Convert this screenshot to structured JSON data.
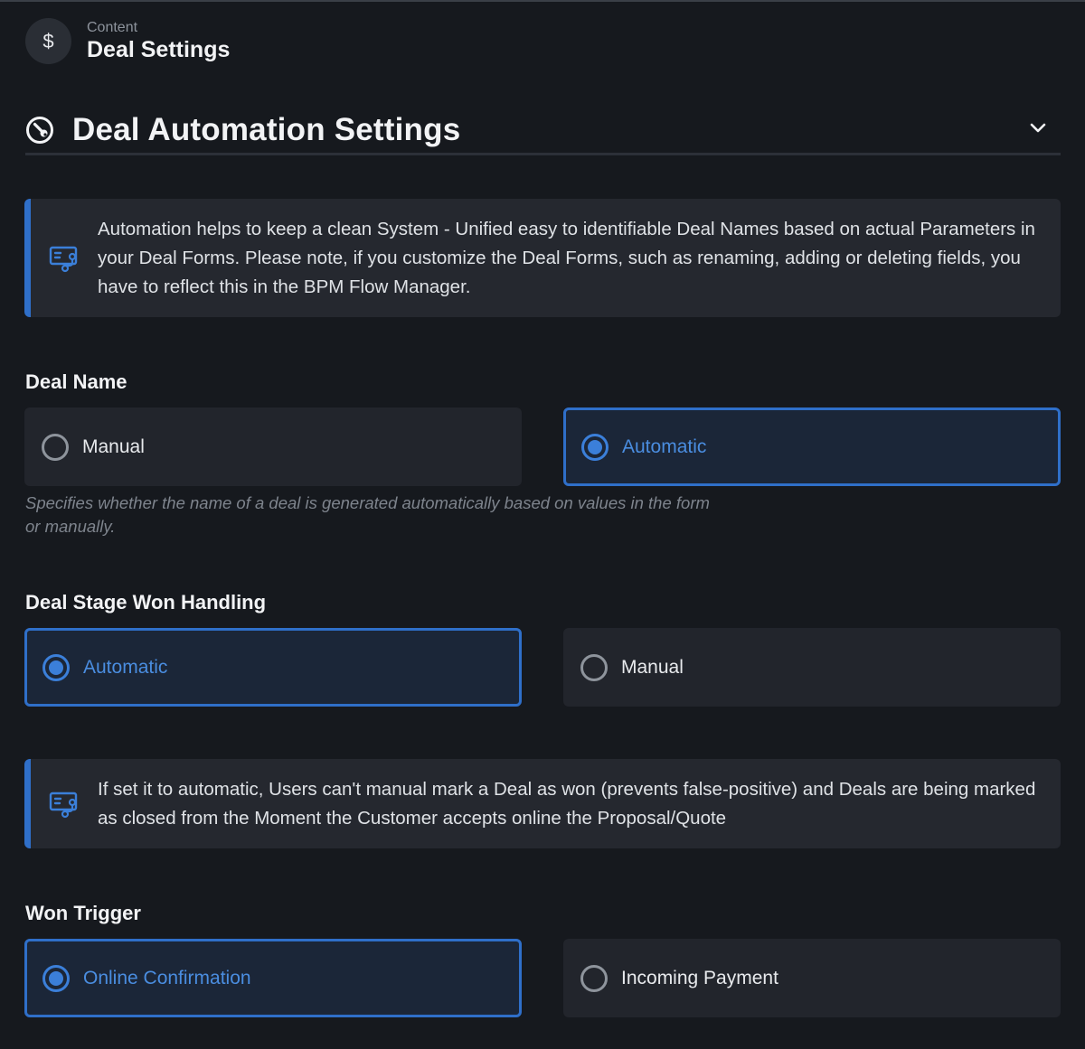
{
  "header": {
    "avatar_icon": "dollar-icon",
    "avatar_glyph": "$",
    "breadcrumb": "Content",
    "title": "Deal Settings"
  },
  "section": {
    "icon": "wrench-circle-icon",
    "title": "Deal Automation Settings",
    "toggle_icon": "chevron-down-icon"
  },
  "info_1": {
    "icon": "flow-form-icon",
    "text": "Automation helps to keep a clean System - Unified easy to identifiable Deal Names based on actual Parameters in your Deal Forms. Please note, if you customize the Deal Forms, such as renaming, adding or deleting fields, you have to reflect this in the BPM Flow Manager."
  },
  "deal_name": {
    "label": "Deal Name",
    "options": [
      {
        "label": "Manual",
        "selected": false
      },
      {
        "label": "Automatic",
        "selected": true
      }
    ],
    "help": "Specifies whether the name of a deal is generated automatically based on values in the form or manually."
  },
  "won_handling": {
    "label": "Deal Stage Won Handling",
    "options": [
      {
        "label": "Automatic",
        "selected": true
      },
      {
        "label": "Manual",
        "selected": false
      }
    ]
  },
  "info_2": {
    "icon": "flow-form-icon",
    "text": "If set it to automatic, Users can't manual mark a Deal as won (prevents false-positive) and Deals are being marked as closed from the Moment the Customer accepts online the Proposal/Quote"
  },
  "won_trigger": {
    "label": "Won Trigger",
    "options": [
      {
        "label": "Online Confirmation",
        "selected": true
      },
      {
        "label": "Incoming Payment",
        "selected": false
      }
    ]
  },
  "colors": {
    "background": "#16191e",
    "card": "#22252c",
    "accent": "#2f6fc9",
    "accent_text": "#4a8de0"
  }
}
